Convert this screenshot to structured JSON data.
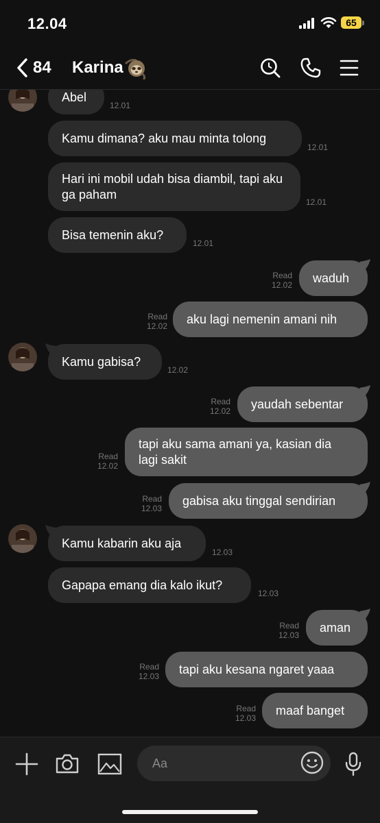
{
  "status_bar": {
    "time": "12.04",
    "battery": "65"
  },
  "header": {
    "back_count": "84",
    "contact_name": "Karina"
  },
  "messages": [
    {
      "dir": "in",
      "text": "Abel",
      "time": "12.01"
    },
    {
      "dir": "in",
      "text": "Kamu dimana? aku mau minta tolong",
      "time": "12.01"
    },
    {
      "dir": "in",
      "text": "Hari ini mobil udah bisa diambil, tapi aku ga paham",
      "time": "12.01"
    },
    {
      "dir": "in",
      "text": "Bisa temenin aku?",
      "time": "12.01"
    },
    {
      "dir": "out",
      "text": "waduh",
      "read": "Read",
      "time": "12.02"
    },
    {
      "dir": "out",
      "text": "aku lagi nemenin amani nih",
      "read": "Read",
      "time": "12.02"
    },
    {
      "dir": "in",
      "text": "Kamu gabisa?",
      "time": "12.02"
    },
    {
      "dir": "out",
      "text": "yaudah sebentar",
      "read": "Read",
      "time": "12.02"
    },
    {
      "dir": "out",
      "text": "tapi aku sama amani ya, kasian dia lagi sakit",
      "read": "Read",
      "time": "12.02"
    },
    {
      "dir": "out",
      "text": "gabisa aku tinggal sendirian",
      "read": "Read",
      "time": "12.03"
    },
    {
      "dir": "in",
      "text": "Kamu kabarin aku aja",
      "time": "12.03"
    },
    {
      "dir": "in",
      "text": "Gapapa emang dia kalo ikut?",
      "time": "12.03"
    },
    {
      "dir": "out",
      "text": "aman",
      "read": "Read",
      "time": "12.03"
    },
    {
      "dir": "out",
      "text": "tapi aku kesana ngaret yaaa",
      "read": "Read",
      "time": "12.03"
    },
    {
      "dir": "out",
      "text": "maaf banget",
      "read": "Read",
      "time": "12.03"
    }
  ],
  "input": {
    "placeholder": "Aa"
  },
  "icons": {
    "header": [
      "back-chevron-icon",
      "search-icon",
      "phone-icon",
      "menu-icon"
    ],
    "input_bar": [
      "plus-icon",
      "camera-icon",
      "image-icon",
      "emoji-icon",
      "microphone-icon"
    ]
  },
  "colors": {
    "background": "#111111",
    "incoming_bubble": "#2b2b2b",
    "outgoing_bubble": "#5a5a5a",
    "meta_text": "#777777",
    "battery": "#f5d547"
  }
}
